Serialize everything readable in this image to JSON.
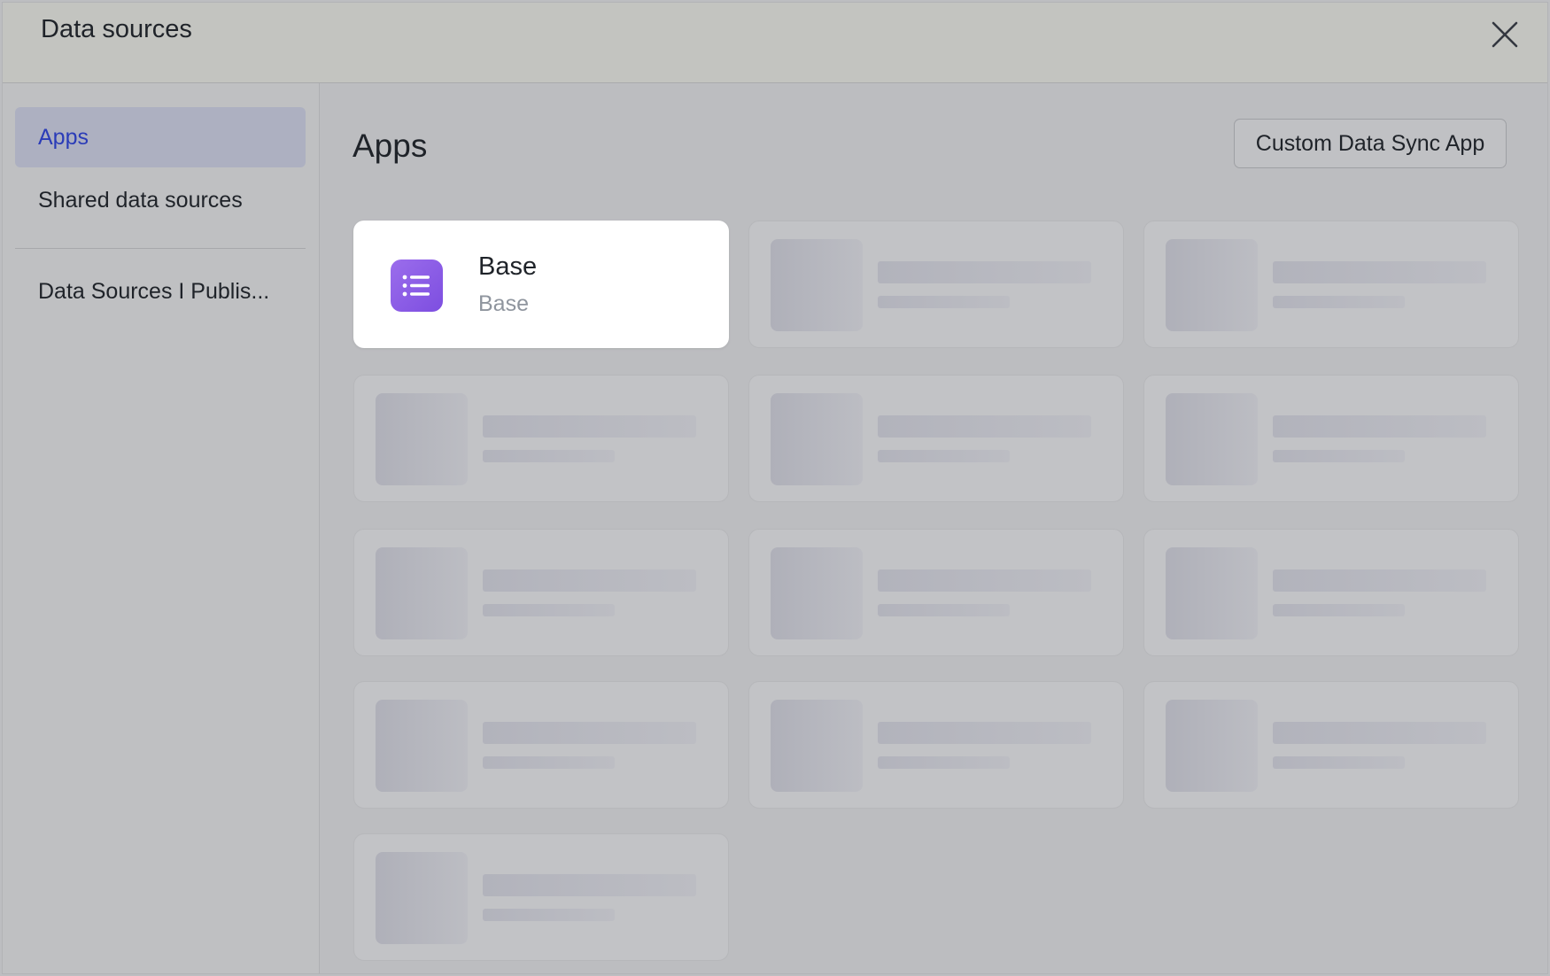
{
  "dialog": {
    "title": "Data sources",
    "close_icon": "close-icon"
  },
  "sidebar": {
    "items": [
      {
        "label": "Apps",
        "active": true
      },
      {
        "label": "Shared data sources",
        "active": false
      },
      {
        "label": "Data Sources I Publis...",
        "active": false
      }
    ]
  },
  "main": {
    "title": "Apps",
    "custom_button_label": "Custom Data Sync App",
    "apps": [
      {
        "name": "Base",
        "subtitle": "Base",
        "icon": "list-icon",
        "icon_color": "#8a5ce6"
      }
    ],
    "loading_placeholder_count": 12
  },
  "colors": {
    "accent": "#2b3cb8",
    "active_bg": "#adb0c1",
    "card_bg": "#ffffff"
  }
}
